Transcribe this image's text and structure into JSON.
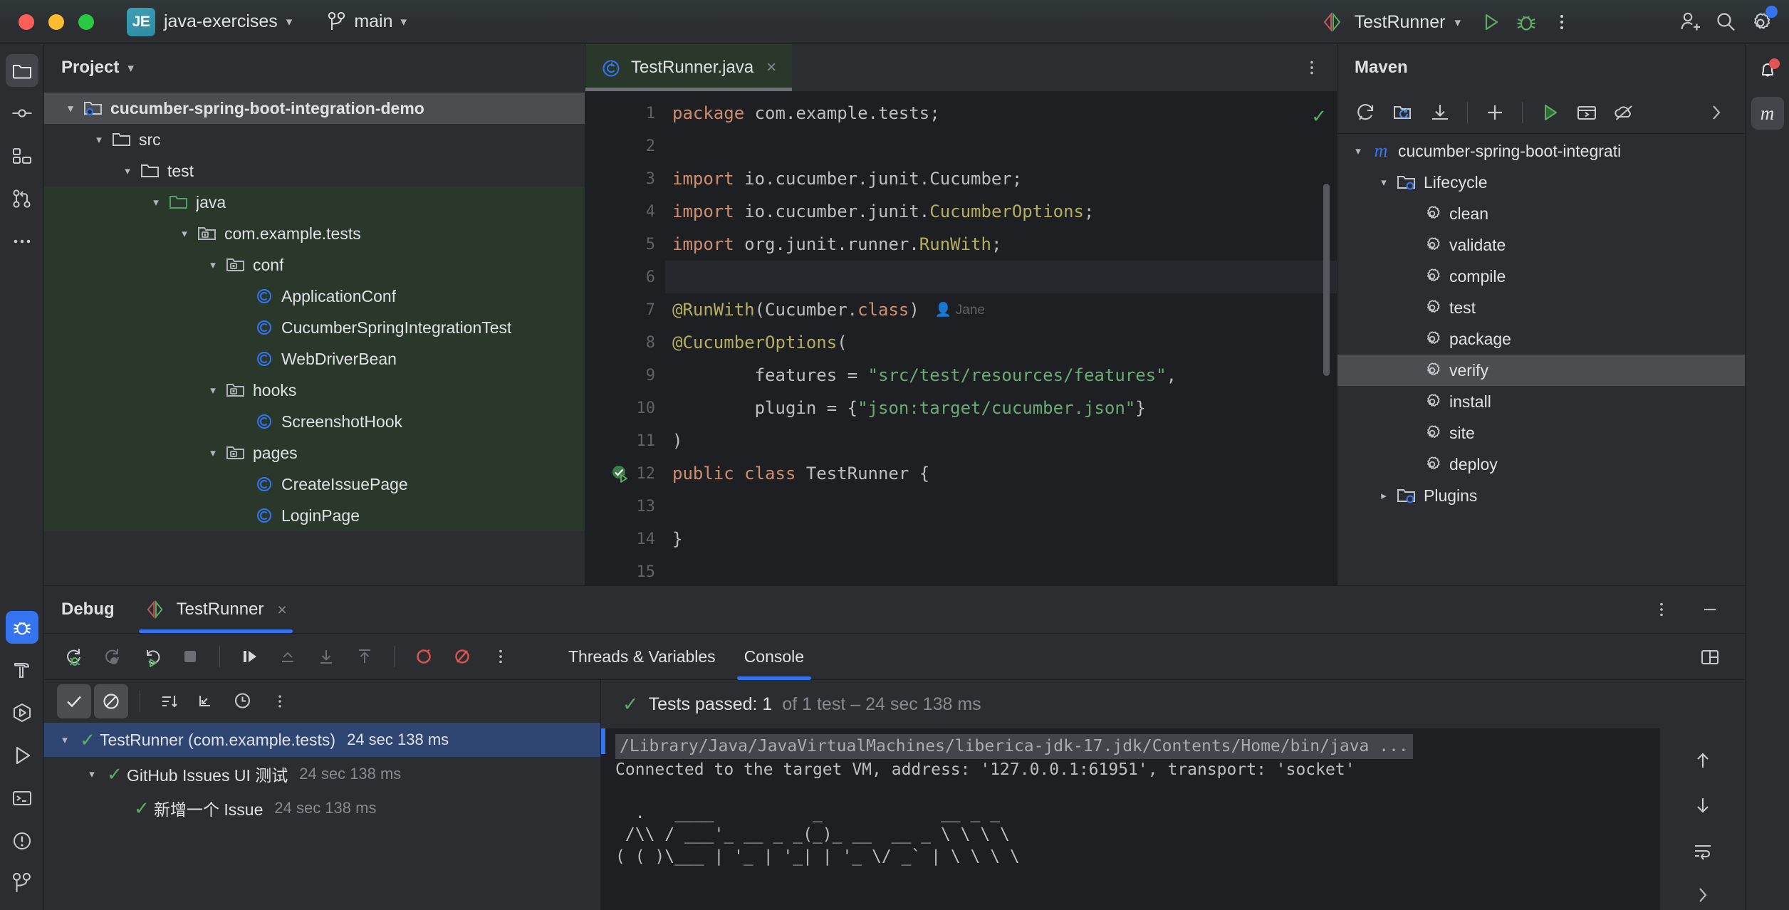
{
  "titlebar": {
    "project_badge": "JE",
    "project_name": "java-exercises",
    "branch_name": "main",
    "run_config": "TestRunner"
  },
  "left_stripe": [
    {
      "name": "project",
      "icon": "folder-icon"
    },
    {
      "name": "commit",
      "icon": "commit-icon"
    },
    {
      "name": "structure",
      "icon": "structure-icon"
    },
    {
      "name": "pull-requests",
      "icon": "pull-request-icon"
    },
    {
      "name": "more-tool-windows",
      "icon": "more-horizontal-icon"
    }
  ],
  "left_stripe_bottom": [
    {
      "name": "debug",
      "icon": "bug-icon"
    },
    {
      "name": "build",
      "icon": "hammer-icon"
    },
    {
      "name": "services",
      "icon": "services-icon"
    },
    {
      "name": "run",
      "icon": "run-icon"
    },
    {
      "name": "terminal",
      "icon": "terminal-icon"
    },
    {
      "name": "problems",
      "icon": "warning-circle-icon"
    },
    {
      "name": "git",
      "icon": "branch-icon"
    }
  ],
  "right_stripe": [
    {
      "name": "notifications",
      "icon": "bell-icon"
    },
    {
      "name": "maven",
      "icon": "m-letter-icon"
    }
  ],
  "project_panel": {
    "title": "Project",
    "tree": [
      {
        "label": "cucumber-spring-boot-integration-demo",
        "indent": 0,
        "arrow": "down",
        "icon": "module-folder-icon",
        "selected": true,
        "bold": true,
        "green": false
      },
      {
        "label": "src",
        "indent": 1,
        "arrow": "down",
        "icon": "folder-icon",
        "selected": false,
        "bold": false,
        "green": false
      },
      {
        "label": "test",
        "indent": 2,
        "arrow": "down",
        "icon": "folder-icon",
        "selected": false,
        "bold": false,
        "green": false
      },
      {
        "label": "java",
        "indent": 3,
        "arrow": "down",
        "icon": "test-source-folder-icon",
        "selected": false,
        "bold": false,
        "green": true
      },
      {
        "label": "com.example.tests",
        "indent": 4,
        "arrow": "down",
        "icon": "package-icon",
        "selected": false,
        "bold": false,
        "green": true
      },
      {
        "label": "conf",
        "indent": 5,
        "arrow": "down",
        "icon": "package-icon",
        "selected": false,
        "bold": false,
        "green": true
      },
      {
        "label": "ApplicationConf",
        "indent": 6,
        "arrow": "",
        "icon": "java-class-icon",
        "selected": false,
        "bold": false,
        "green": true
      },
      {
        "label": "CucumberSpringIntegrationTest",
        "indent": 6,
        "arrow": "",
        "icon": "java-class-icon",
        "selected": false,
        "bold": false,
        "green": true
      },
      {
        "label": "WebDriverBean",
        "indent": 6,
        "arrow": "",
        "icon": "java-class-icon",
        "selected": false,
        "bold": false,
        "green": true
      },
      {
        "label": "hooks",
        "indent": 5,
        "arrow": "down",
        "icon": "package-icon",
        "selected": false,
        "bold": false,
        "green": true
      },
      {
        "label": "ScreenshotHook",
        "indent": 6,
        "arrow": "",
        "icon": "java-class-icon",
        "selected": false,
        "bold": false,
        "green": true
      },
      {
        "label": "pages",
        "indent": 5,
        "arrow": "down",
        "icon": "package-icon",
        "selected": false,
        "bold": false,
        "green": true
      },
      {
        "label": "CreateIssuePage",
        "indent": 6,
        "arrow": "",
        "icon": "java-class-icon",
        "selected": false,
        "bold": false,
        "green": true
      },
      {
        "label": "LoginPage",
        "indent": 6,
        "arrow": "",
        "icon": "java-class-icon",
        "selected": false,
        "bold": false,
        "green": true
      }
    ]
  },
  "editor": {
    "tab_name": "TestRunner.java",
    "tab_close": "×",
    "inlay_hint_author": "Jane",
    "lines": [
      {
        "n": "1",
        "html": "<span class='kw'>package</span> com.example.tests;"
      },
      {
        "n": "2",
        "html": ""
      },
      {
        "n": "3",
        "html": "<span class='kw'>import</span> io.cucumber.junit.Cucumber;"
      },
      {
        "n": "4",
        "html": "<span class='kw'>import</span> io.cucumber.junit.<span class='ann'>CucumberOptions</span>;"
      },
      {
        "n": "5",
        "html": "<span class='kw'>import</span> org.junit.runner.<span class='ann'>RunWith</span>;"
      },
      {
        "n": "6",
        "html": "",
        "current": true
      },
      {
        "n": "7",
        "html": "<span class='ann'>@RunWith</span>(Cucumber.<span class='kw'>class</span>)",
        "inlay": true
      },
      {
        "n": "8",
        "html": "<span class='ann'>@CucumberOptions</span>("
      },
      {
        "n": "9",
        "html": "        features = <span class='str'>\"src/test/resources/features\"</span>,"
      },
      {
        "n": "10",
        "html": "        plugin = {<span class='str'>\"json:target/cucumber.json\"</span>}"
      },
      {
        "n": "11",
        "html": ")"
      },
      {
        "n": "12",
        "html": "<span class='kw'>public class</span> TestRunner {",
        "gutter_run": true
      },
      {
        "n": "13",
        "html": ""
      },
      {
        "n": "14",
        "html": "}"
      },
      {
        "n": "15",
        "html": ""
      }
    ]
  },
  "maven_panel": {
    "title": "Maven",
    "toolbar": [
      {
        "name": "reload-all-maven-projects",
        "icon": "refresh-icon"
      },
      {
        "name": "reload-project",
        "icon": "folder-refresh-icon"
      },
      {
        "name": "download-sources",
        "icon": "download-icon"
      },
      {
        "name": "add-maven-project",
        "icon": "plus-icon"
      },
      {
        "name": "run-maven-goal",
        "icon": "run-icon"
      },
      {
        "name": "execute-maven-goal",
        "icon": "terminal-window-icon"
      },
      {
        "name": "toggle-offline-mode",
        "icon": "cloud-off-icon"
      },
      {
        "name": "expand-toolbar",
        "icon": "chevron-right-icon"
      }
    ],
    "tree": [
      {
        "label": "cucumber-spring-boot-integrati",
        "indent": 0,
        "arrow": "down",
        "icon": "maven-m-icon",
        "selected": false
      },
      {
        "label": "Lifecycle",
        "indent": 1,
        "arrow": "down",
        "icon": "lifecycle-folder-icon",
        "selected": false
      },
      {
        "label": "clean",
        "indent": 2,
        "arrow": "",
        "icon": "maven-goal-icon",
        "selected": false
      },
      {
        "label": "validate",
        "indent": 2,
        "arrow": "",
        "icon": "maven-goal-icon",
        "selected": false
      },
      {
        "label": "compile",
        "indent": 2,
        "arrow": "",
        "icon": "maven-goal-icon",
        "selected": false
      },
      {
        "label": "test",
        "indent": 2,
        "arrow": "",
        "icon": "maven-goal-icon",
        "selected": false
      },
      {
        "label": "package",
        "indent": 2,
        "arrow": "",
        "icon": "maven-goal-icon",
        "selected": false
      },
      {
        "label": "verify",
        "indent": 2,
        "arrow": "",
        "icon": "maven-goal-icon",
        "selected": true
      },
      {
        "label": "install",
        "indent": 2,
        "arrow": "",
        "icon": "maven-goal-icon",
        "selected": false
      },
      {
        "label": "site",
        "indent": 2,
        "arrow": "",
        "icon": "maven-goal-icon",
        "selected": false
      },
      {
        "label": "deploy",
        "indent": 2,
        "arrow": "",
        "icon": "maven-goal-icon",
        "selected": false
      },
      {
        "label": "Plugins",
        "indent": 1,
        "arrow": "right",
        "icon": "lifecycle-folder-icon",
        "selected": false
      }
    ]
  },
  "debug_panel": {
    "title": "Debug",
    "session_tab": "TestRunner",
    "session_tab_close": "×",
    "toolbar": [
      {
        "name": "rerun-debug",
        "icon": "rerun-debug-icon"
      },
      {
        "name": "resume-program",
        "icon": "resume-icon"
      },
      {
        "name": "restart-debug",
        "icon": "restart-debug-icon"
      },
      {
        "name": "stop",
        "icon": "stop-icon"
      },
      {
        "name": "step-over",
        "icon": "step-over-icon"
      },
      {
        "name": "step-out",
        "icon": "step-out-icon"
      },
      {
        "name": "step-into",
        "icon": "step-into-icon"
      },
      {
        "name": "force-step-into",
        "icon": "force-step-into-icon"
      },
      {
        "name": "view-breakpoints",
        "icon": "breakpoint-icon"
      },
      {
        "name": "mute-breakpoints",
        "icon": "mute-breakpoints-icon"
      },
      {
        "name": "more-options",
        "icon": "more-vertical-icon"
      }
    ],
    "tabs": [
      {
        "label": "Threads & Variables",
        "active": false
      },
      {
        "label": "Console",
        "active": true
      }
    ],
    "layout_button": "layout-settings-icon",
    "more_button": "more-vertical-icon",
    "minimize_button": "minimize-icon"
  },
  "test_results": {
    "toolbar": [
      {
        "name": "show-passed",
        "icon": "check-icon",
        "on": true
      },
      {
        "name": "show-ignored",
        "icon": "ignored-icon",
        "on": true
      },
      {
        "name": "sort-alphabetically",
        "icon": "sort-icon",
        "on": false
      },
      {
        "name": "expand-collapse",
        "icon": "collapse-icon",
        "on": false
      },
      {
        "name": "sort-by-duration",
        "icon": "clock-icon",
        "on": false
      },
      {
        "name": "more-options",
        "icon": "more-vertical-icon",
        "on": false
      }
    ],
    "rows": [
      {
        "label": "TestRunner (com.example.tests)",
        "time": "24 sec 138 ms",
        "indent": 0,
        "arrow": "down",
        "selected": true
      },
      {
        "label": "GitHub Issues UI 测试",
        "time": "24 sec 138 ms",
        "indent": 1,
        "arrow": "down",
        "selected": false
      },
      {
        "label": "新增一个 Issue",
        "time": "24 sec 138 ms",
        "indent": 2,
        "arrow": "",
        "selected": false
      }
    ]
  },
  "console": {
    "status_main": "Tests passed: 1",
    "status_sub": "of 1 test – 24 sec 138 ms",
    "command_line": "/Library/Java/JavaVirtualMachines/liberica-jdk-17.jdk/Contents/Home/bin/java ...",
    "output_lines": [
      "Connected to the target VM, address: '127.0.0.1:61951', transport: 'socket'",
      "",
      "  .   ____          _            __ _ _",
      " /\\\\ / ___'_ __ _ _(_)_ __  __ _ \\ \\ \\ \\",
      "( ( )\\___ | '_ | '_| | '_ \\/ _` | \\ \\ \\ \\"
    ],
    "side_buttons": [
      {
        "name": "scroll-up",
        "icon": "arrow-up-icon"
      },
      {
        "name": "scroll-down",
        "icon": "arrow-down-icon"
      },
      {
        "name": "soft-wrap",
        "icon": "soft-wrap-icon"
      },
      {
        "name": "expand-console",
        "icon": "chevron-right-icon"
      }
    ]
  },
  "colors": {
    "accent_blue": "#3574f0",
    "success_green": "#5fad65",
    "test_root_green": "#2a382b",
    "selection_blue": "#2f4673",
    "notification_red": "#e05555",
    "keyword_orange": "#cf8e6d",
    "annotation_yellow": "#b3ae60",
    "string_green": "#6aab73"
  }
}
